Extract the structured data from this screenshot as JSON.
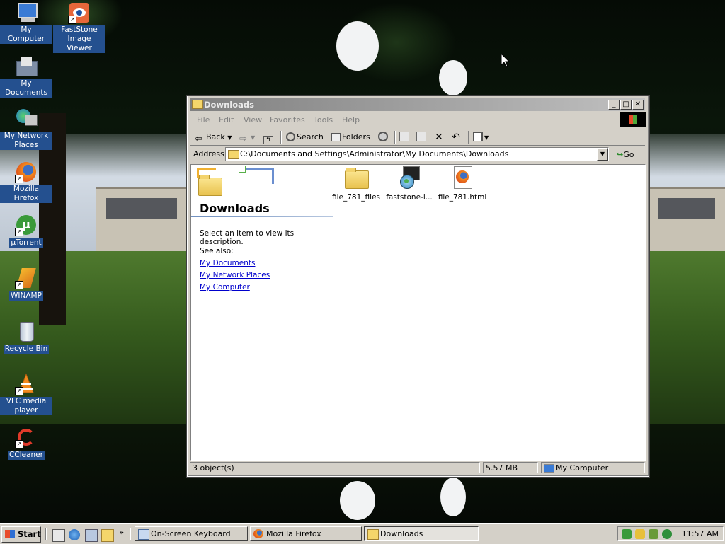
{
  "desktop": {
    "icons": [
      {
        "label": "My Computer",
        "icon": "my-computer-icon"
      },
      {
        "label": "FastStone Image Viewer",
        "icon": "faststone-icon"
      },
      {
        "label": "My Documents",
        "icon": "my-documents-icon"
      },
      {
        "label": "My Network Places",
        "icon": "network-places-icon"
      },
      {
        "label": "Mozilla Firefox",
        "icon": "firefox-icon"
      },
      {
        "label": "µTorrent",
        "icon": "utorrent-icon"
      },
      {
        "label": "WINAMP",
        "icon": "winamp-icon"
      },
      {
        "label": "Recycle Bin",
        "icon": "recycle-bin-icon"
      },
      {
        "label": "VLC media player",
        "icon": "vlc-icon"
      },
      {
        "label": "CCleaner",
        "icon": "ccleaner-icon"
      }
    ]
  },
  "window": {
    "title": "Downloads",
    "menu": [
      "File",
      "Edit",
      "View",
      "Favorites",
      "Tools",
      "Help"
    ],
    "toolbar": {
      "back": "Back",
      "search": "Search",
      "folders": "Folders"
    },
    "address": {
      "label": "Address",
      "value": "C:\\Documents and Settings\\Administrator\\My Documents\\Downloads",
      "go": "Go"
    },
    "task_pane": {
      "title": "Downloads",
      "description": "Select an item to view its description.",
      "see_also_label": "See also:",
      "links": [
        "My Documents",
        "My Network Places",
        "My Computer"
      ]
    },
    "files": [
      {
        "name": "file_781_files",
        "icon": "folder-icon"
      },
      {
        "name": "faststone-i...",
        "icon": "installer-icon"
      },
      {
        "name": "file_781.html",
        "icon": "firefox-html-icon"
      }
    ],
    "status": {
      "objects": "3 object(s)",
      "size": "5.57 MB",
      "zone": "My Computer"
    }
  },
  "taskbar": {
    "start": "Start",
    "tasks": [
      "On-Screen Keyboard",
      "Mozilla Firefox",
      "Downloads"
    ],
    "clock": "11:57 AM"
  }
}
